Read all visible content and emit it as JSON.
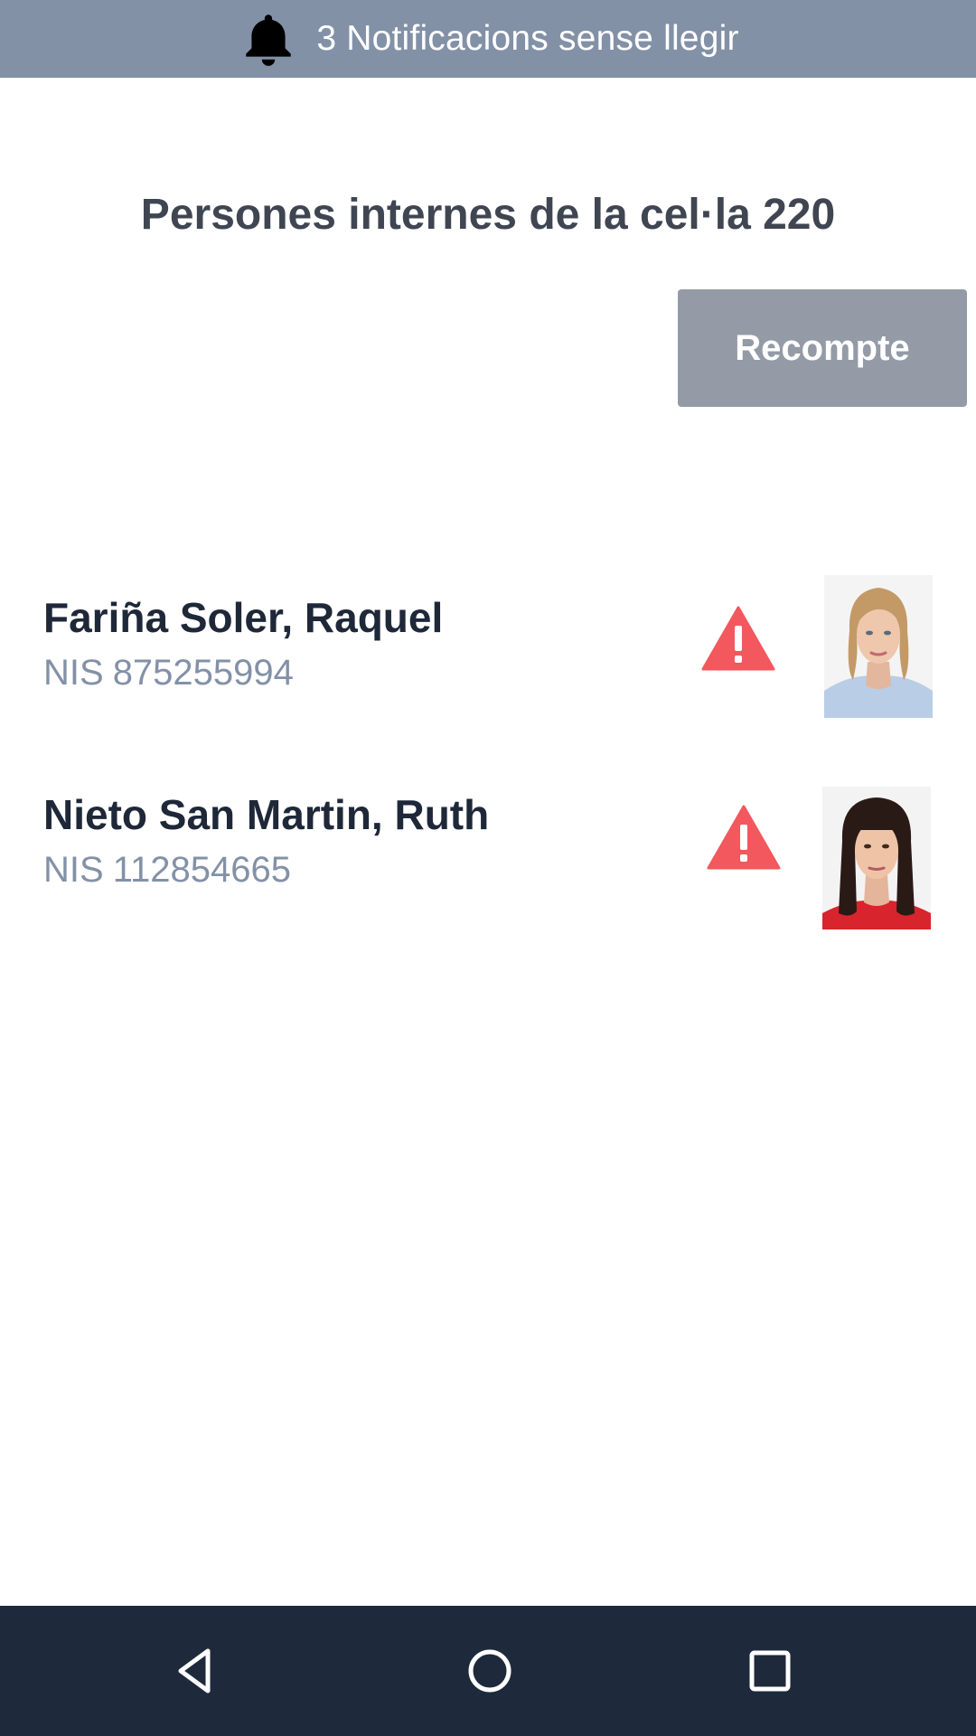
{
  "notification_bar": {
    "text": "3 Notificacions sense llegir",
    "icon": "bell-icon",
    "background": "#8391a7"
  },
  "page": {
    "title": "Persones internes de la cel·la 220"
  },
  "recount_button": {
    "label": "Recompte",
    "background": "#949ba6"
  },
  "inmates": [
    {
      "name": "Fariña Soler, Raquel",
      "nis_prefix": "NIS",
      "nis": "875255994",
      "alert_icon": "warning-icon",
      "photo": "person-photo"
    },
    {
      "name": "Nieto San Martin, Ruth",
      "nis_prefix": "NIS",
      "nis": "112854665",
      "alert_icon": "warning-icon",
      "photo": "person-photo"
    }
  ],
  "colors": {
    "alert": "#f2585d",
    "name_text": "#1e2838",
    "nis_text": "#8391a7",
    "title_text": "#3f4652",
    "nav_bar": "#1e2a3b"
  },
  "nav_bar": {
    "back_icon": "back-triangle-icon",
    "home_icon": "home-circle-icon",
    "recents_icon": "recents-square-icon"
  }
}
